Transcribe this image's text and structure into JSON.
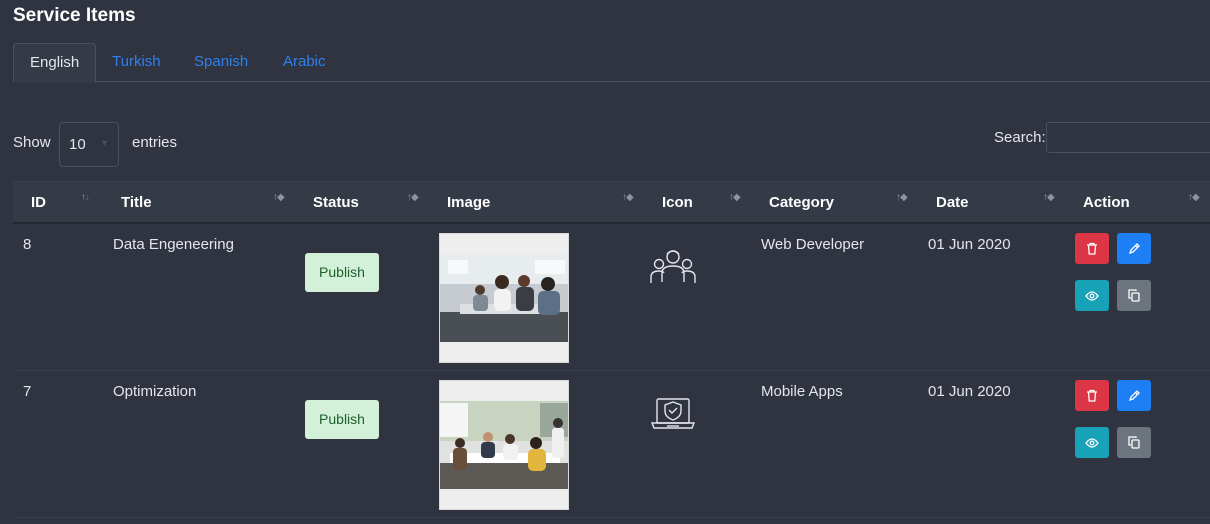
{
  "page": {
    "title": "Service Items"
  },
  "tabs": [
    {
      "label": "English",
      "active": true
    },
    {
      "label": "Turkish",
      "active": false
    },
    {
      "label": "Spanish",
      "active": false
    },
    {
      "label": "Arabic",
      "active": false
    }
  ],
  "controls": {
    "show_label": "Show",
    "entries_value": "10",
    "entries_label": "entries",
    "search_label": "Search:",
    "search_value": ""
  },
  "table": {
    "columns": [
      "ID",
      "Title",
      "Status",
      "Image",
      "Icon",
      "Category",
      "Date",
      "Action"
    ],
    "rows": [
      {
        "id": "8",
        "title": "Data Engeneering",
        "status": "Publish",
        "image": "team-meeting-photo",
        "icon": "team-people-icon",
        "category": "Web Developer",
        "date": "01 Jun 2020"
      },
      {
        "id": "7",
        "title": "Optimization",
        "status": "Publish",
        "image": "office-meeting-photo",
        "icon": "laptop-shield-icon",
        "category": "Mobile Apps",
        "date": "01 Jun 2020"
      }
    ]
  },
  "colors": {
    "background": "#2f3440",
    "accent": "#2f80ed",
    "status_publish_bg": "#d3f1d8",
    "delete": "#dc3545",
    "edit": "#1e7ff5",
    "view": "#17a2b8",
    "copy": "#6c757d"
  }
}
